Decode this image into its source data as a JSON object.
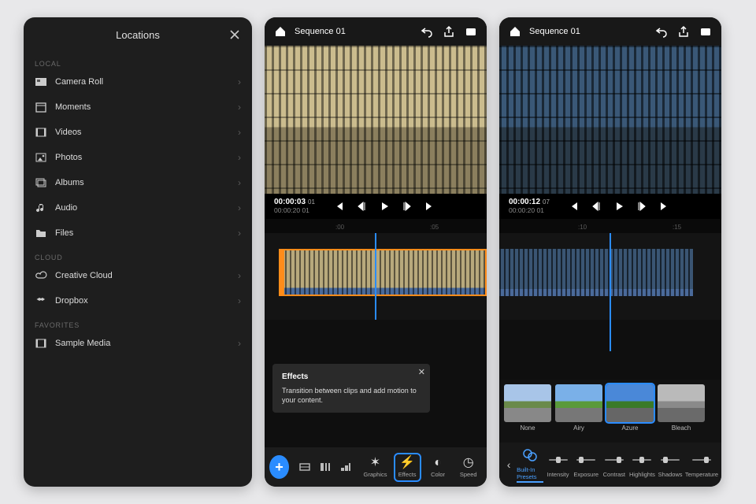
{
  "panel1": {
    "title": "Locations",
    "sections": {
      "local": {
        "header": "LOCAL",
        "items": [
          {
            "label": "Camera Roll",
            "icon": "camera-roll-icon"
          },
          {
            "label": "Moments",
            "icon": "calendar-icon"
          },
          {
            "label": "Videos",
            "icon": "filmstrip-icon"
          },
          {
            "label": "Photos",
            "icon": "image-icon"
          },
          {
            "label": "Albums",
            "icon": "albums-icon"
          },
          {
            "label": "Audio",
            "icon": "music-note-icon"
          },
          {
            "label": "Files",
            "icon": "folder-icon"
          }
        ]
      },
      "cloud": {
        "header": "CLOUD",
        "items": [
          {
            "label": "Creative Cloud",
            "icon": "creative-cloud-icon"
          },
          {
            "label": "Dropbox",
            "icon": "dropbox-icon"
          }
        ]
      },
      "favorites": {
        "header": "FAVORITES",
        "items": [
          {
            "label": "Sample Media",
            "icon": "filmstrip-icon"
          }
        ]
      }
    }
  },
  "panel2": {
    "sequence_title": "Sequence 01",
    "time_current": "00:00:03",
    "time_frames": "01",
    "time_total": "00:00:20  01",
    "ruler": {
      "t0": ":00",
      "t1": ":05"
    },
    "popup": {
      "title": "Effects",
      "body": "Transition between clips and add motion to your content."
    },
    "bottom_tabs": [
      {
        "label": "Graphics",
        "icon": "graphics-icon"
      },
      {
        "label": "Effects",
        "icon": "effects-icon",
        "active": true
      },
      {
        "label": "Color",
        "icon": "color-icon"
      },
      {
        "label": "Speed",
        "icon": "speed-icon"
      }
    ]
  },
  "panel3": {
    "sequence_title": "Sequence 01",
    "time_current": "00:00:12",
    "time_frames": "07",
    "time_total": "00:00:20  01",
    "ruler": {
      "t0": ":10",
      "t1": ":15"
    },
    "presets": [
      {
        "name": "None",
        "cls": "th-none"
      },
      {
        "name": "Airy",
        "cls": "th-airy"
      },
      {
        "name": "Azure",
        "cls": "th-azure",
        "selected": true
      },
      {
        "name": "Bleach",
        "cls": "th-bleach"
      }
    ],
    "adjust": [
      {
        "label": "Built-In Presets",
        "active": true,
        "icon": "presets-icon"
      },
      {
        "label": "Intensity",
        "icon": "slider-icon"
      },
      {
        "label": "Exposure",
        "icon": "slider-icon"
      },
      {
        "label": "Contrast",
        "icon": "slider-icon"
      },
      {
        "label": "Highlights",
        "icon": "slider-icon"
      },
      {
        "label": "Shadows",
        "icon": "slider-icon"
      },
      {
        "label": "Temperature",
        "icon": "slider-icon"
      }
    ]
  }
}
